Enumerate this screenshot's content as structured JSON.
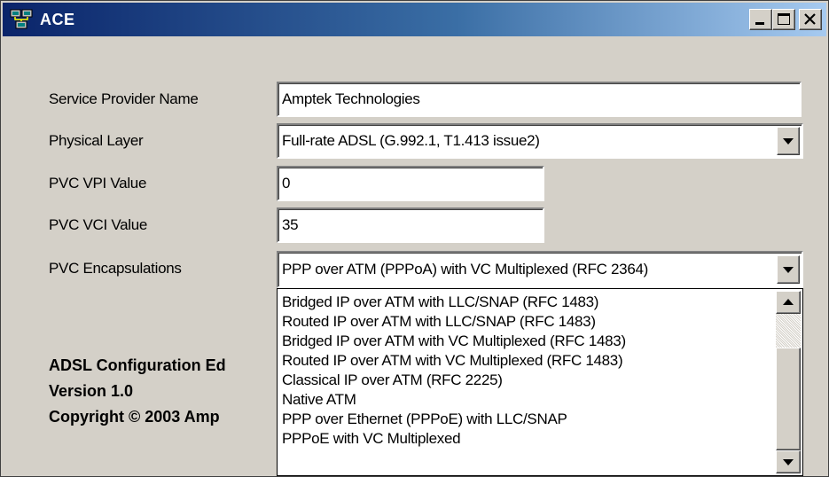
{
  "window": {
    "title": "ACE"
  },
  "form": {
    "service_provider_label": "Service Provider Name",
    "service_provider_value": "Amptek Technologies",
    "physical_layer_label": "Physical Layer",
    "physical_layer_value": "Full-rate ADSL (G.992.1, T1.413 issue2)",
    "vpi_label": "PVC VPI Value",
    "vpi_value": "0",
    "vci_label": "PVC VCI Value",
    "vci_value": "35",
    "encapsulation_label": "PVC Encapsulations",
    "encapsulation_value": "PPP over ATM (PPPoA) with VC Multiplexed (RFC 2364)"
  },
  "encapsulation_options": [
    "Bridged IP over ATM with LLC/SNAP (RFC 1483)",
    "Routed IP over ATM with LLC/SNAP (RFC 1483)",
    "Bridged IP over ATM with VC Multiplexed (RFC 1483)",
    "Routed IP over ATM with VC Multiplexed (RFC 1483)",
    "Classical IP over ATM (RFC 2225)",
    "Native ATM",
    "PPP over Ethernet (PPPoE) with LLC/SNAP",
    "PPPoE with VC Multiplexed"
  ],
  "about": {
    "line1": "ADSL Configuration Ed",
    "line2": "Version 1.0",
    "line3": "Copyright © 2003 Amp"
  },
  "icons": {
    "app": "network-computer-icon",
    "minimize": "minimize-icon",
    "maximize": "maximize-icon",
    "close": "close-icon",
    "combo": "chevron-down-icon"
  },
  "colors": {
    "title_bar_start": "#0a246a",
    "title_bar_end": "#a6caf0",
    "window_face": "#d4d0c8"
  }
}
